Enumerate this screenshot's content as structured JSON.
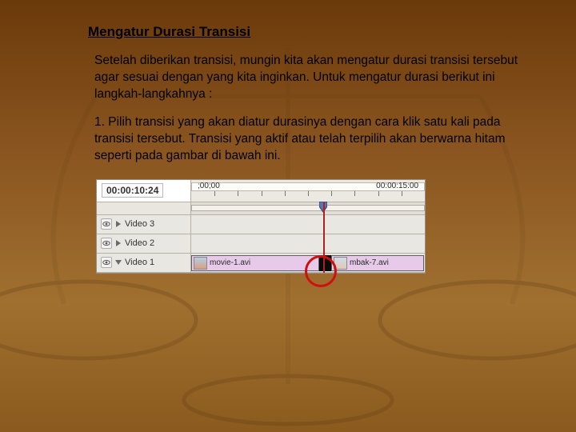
{
  "title": "Mengatur Durasi Transisi",
  "para1": "Setelah diberikan transisi, mungin kita akan mengatur durasi transisi tersebut agar sesuai dengan yang kita inginkan. Untuk mengatur durasi berikut ini langkah-langkahnya :",
  "step1_num": "1. ",
  "step1_body": "Pilih transisi yang akan diatur durasinya dengan cara klik satu kali pada transisi tersebut. Transisi yang aktif atau telah terpilih akan berwarna hitam seperti pada gambar di bawah ini.",
  "editor": {
    "timecode": "00:00:10:24",
    "ruler_start": ";00;00",
    "ruler_end": "00:00:15:00",
    "tracks": {
      "v3": "Video 3",
      "v2": "Video 2",
      "v1": "Video 1"
    },
    "clip_left": "movie-1.avi",
    "clip_right": "mbak-7.avi"
  }
}
